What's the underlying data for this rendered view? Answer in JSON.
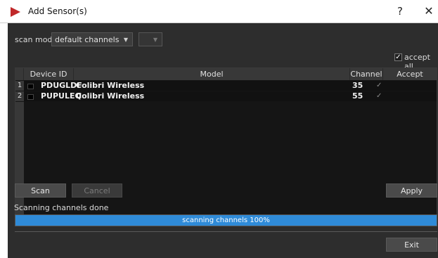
{
  "window": {
    "title": "Add Sensor(s)",
    "help_label": "?",
    "close_label": "✕",
    "accent_color": "#c0282a"
  },
  "scan": {
    "mode_label": "scan mode",
    "mode_value": "default channels",
    "secondary_value": "",
    "accept_all_label": "accept all",
    "accept_all_checked": true
  },
  "table": {
    "columns": [
      "Device ID",
      "Model",
      "Channel",
      "Accept"
    ],
    "rows": [
      {
        "num": "1",
        "device_id": "PDUGLDF",
        "model": "Colibri Wireless",
        "channel": "35",
        "accept": "✓"
      },
      {
        "num": "2",
        "device_id": "PUPULEQ",
        "model": "Colibri Wireless",
        "channel": "55",
        "accept": "✓"
      }
    ]
  },
  "buttons": {
    "scan": "Scan",
    "cancel": "Cancel",
    "apply": "Apply",
    "exit": "Exit"
  },
  "status": {
    "text": "Scanning channels done",
    "progress_label": "scanning channels 100%",
    "progress_fraction": 1.0,
    "progress_color": "#2f8bd8"
  }
}
